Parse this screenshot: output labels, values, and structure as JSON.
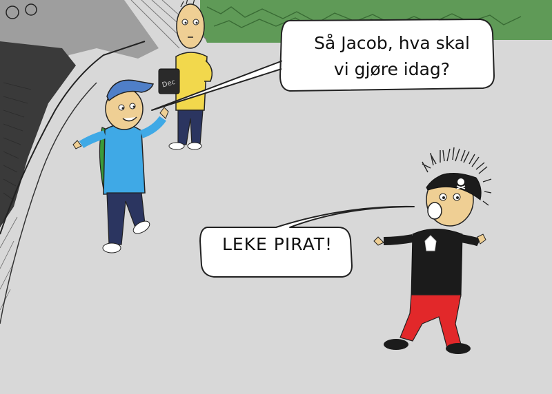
{
  "comic": {
    "speech_top": "Så Jacob, hva skal\nvi gjøre idag?",
    "speech_bottom": "LEKE PIRAT!"
  },
  "colors": {
    "background_ground": "#d8d8d8",
    "grass": "#5f9a57",
    "blue_cap": "#4f7fc8",
    "blue_shirt": "#3fa9e6",
    "yellow_shirt": "#f2d84c",
    "red_pants": "#e2282a",
    "black_shirt": "#1b1b1b",
    "skin": "#efcf94"
  }
}
